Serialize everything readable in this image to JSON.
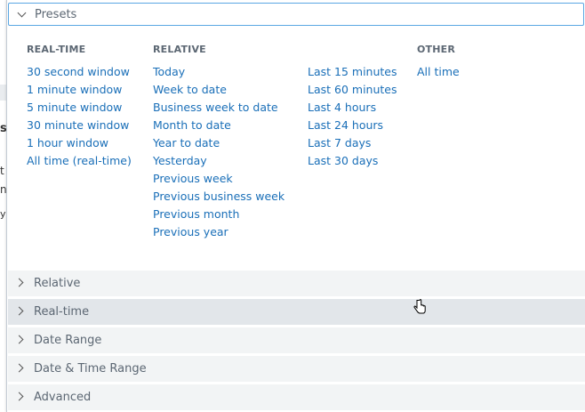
{
  "background": {
    "fragments": [
      "s",
      "t",
      "n",
      "y ."
    ]
  },
  "presets": {
    "header_label": "Presets",
    "columns": [
      {
        "heading": "REAL-TIME",
        "items": [
          "30 second window",
          "1 minute window",
          "5 minute window",
          "30 minute window",
          "1 hour window",
          "All time (real-time)"
        ]
      },
      {
        "heading": "RELATIVE",
        "items": [
          "Today",
          "Week to date",
          "Business week to date",
          "Month to date",
          "Year to date",
          "Yesterday",
          "Previous week",
          "Previous business week",
          "Previous month",
          "Previous year"
        ]
      },
      {
        "heading": "",
        "items": [
          "Last 15 minutes",
          "Last 60 minutes",
          "Last 4 hours",
          "Last 24 hours",
          "Last 7 days",
          "Last 30 days"
        ]
      },
      {
        "heading": "OTHER",
        "items": [
          "All time"
        ]
      }
    ]
  },
  "sections": [
    "Relative",
    "Real-time",
    "Date Range",
    "Date & Time Range",
    "Advanced"
  ],
  "colors": {
    "link": "#1a6fb8",
    "heading": "#5c6773",
    "header_border": "#5aa7e3",
    "section_bg": "#f2f4f5",
    "section_hover_bg": "#e2e6ea"
  }
}
